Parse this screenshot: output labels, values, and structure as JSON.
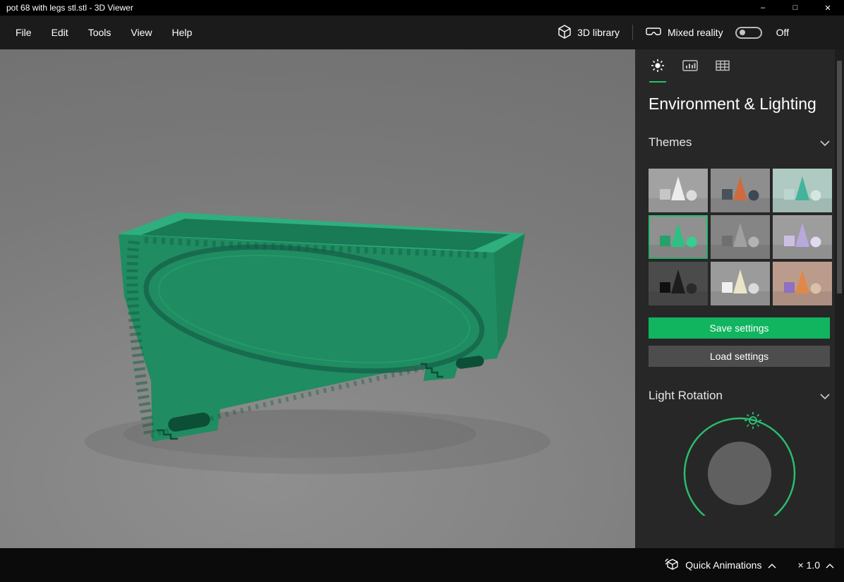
{
  "window": {
    "title": "pot 68 with legs stl.stl - 3D Viewer"
  },
  "window_controls": {
    "minimize": "–",
    "maximize": "□",
    "close": "✕"
  },
  "menubar": {
    "items": [
      "File",
      "Edit",
      "Tools",
      "View",
      "Help"
    ]
  },
  "toolbar": {
    "library_label": "3D library",
    "mixed_reality_label": "Mixed reality",
    "mixed_reality_state": "Off"
  },
  "panel": {
    "tabs": [
      {
        "name": "environment-lighting",
        "icon": "sun-icon",
        "selected": true
      },
      {
        "name": "stats-shading",
        "icon": "stats-icon",
        "selected": false
      },
      {
        "name": "grid-views",
        "icon": "grid-icon",
        "selected": false
      }
    ],
    "heading": "Environment & Lighting",
    "themes_label": "Themes",
    "theme_items": [
      {
        "bg": "#a2a2a2",
        "cone": "#ececec",
        "cube": "#c6c6c6",
        "sphere": "#dcdcdc",
        "selected": false
      },
      {
        "bg": "#8e8e8e",
        "cone": "#cf6a3e",
        "cube": "#49525a",
        "sphere": "#3d4854",
        "selected": false
      },
      {
        "bg": "#aecac3",
        "cone": "#43b39b",
        "cube": "#bcd6cf",
        "sphere": "#d6e6e1",
        "selected": false
      },
      {
        "bg": "#909090",
        "cone": "#2fbf82",
        "cube": "#27a06c",
        "sphere": "#35cf8f",
        "selected": true
      },
      {
        "bg": "#858585",
        "cone": "#a0a0a0",
        "cube": "#6f6f6f",
        "sphere": "#b3b3b3",
        "selected": false
      },
      {
        "bg": "#9d9d9d",
        "cone": "#b9a8dc",
        "cube": "#cdbfe4",
        "sphere": "#e2d8ef",
        "selected": false
      },
      {
        "bg": "#4b4b4b",
        "cone": "#1d1d1d",
        "cube": "#0f0f0f",
        "sphere": "#2a2a2a",
        "selected": false
      },
      {
        "bg": "#9b9b9b",
        "cone": "#eae5c9",
        "cube": "#f0f0f0",
        "sphere": "#dadada",
        "selected": false
      },
      {
        "bg": "#bb9c8c",
        "cone": "#e0884a",
        "cube": "#8f6fc0",
        "sphere": "#d9c1a9",
        "selected": false
      }
    ],
    "save_label": "Save settings",
    "load_label": "Load settings",
    "light_rotation_label": "Light Rotation"
  },
  "statusbar": {
    "quick_animations_label": "Quick Animations",
    "zoom_label": "× 1.0"
  },
  "colors": {
    "accent_green": "#11b45f",
    "dial_green": "#2abd6f",
    "panel_bg": "#272727",
    "model_green": "#1f8c61"
  }
}
